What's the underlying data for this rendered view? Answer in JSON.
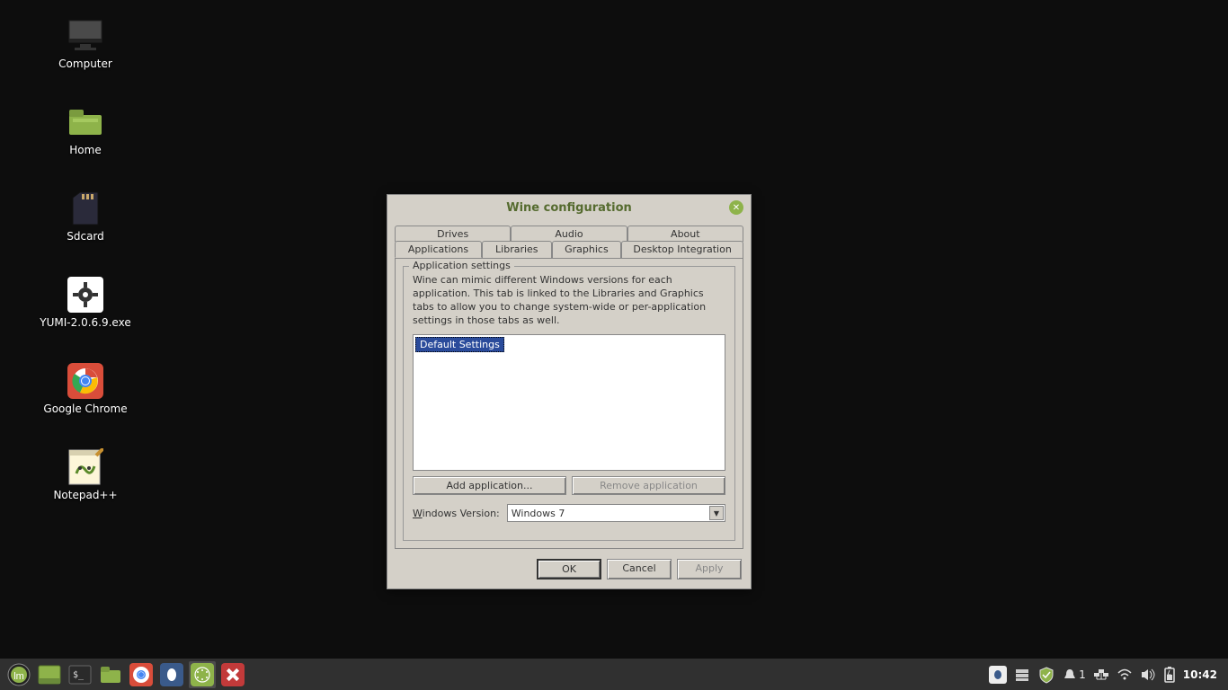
{
  "desktop": {
    "icons": [
      {
        "label": "Computer"
      },
      {
        "label": "Home"
      },
      {
        "label": "Sdcard"
      },
      {
        "label": "YUMI-2.0.6.9.exe"
      },
      {
        "label": "Google Chrome"
      },
      {
        "label": "Notepad++"
      }
    ]
  },
  "window": {
    "title": "Wine configuration",
    "tabs_row1": [
      {
        "label": "Drives"
      },
      {
        "label": "Audio"
      },
      {
        "label": "About"
      }
    ],
    "tabs_row2": [
      {
        "label": "Applications"
      },
      {
        "label": "Libraries"
      },
      {
        "label": "Graphics"
      },
      {
        "label": "Desktop Integration"
      }
    ],
    "active_tab": "Applications",
    "group_title": "Application settings",
    "description": "Wine can mimic different Windows versions for each application. This tab is linked to the Libraries and Graphics tabs to allow you to change system-wide or per-application settings in those tabs as well.",
    "list_selected": "Default Settings",
    "add_button": "Add application...",
    "remove_button": "Remove application",
    "version_label": "Windows Version:",
    "version_value": "Windows 7",
    "footer": {
      "ok": "OK",
      "cancel": "Cancel",
      "apply": "Apply"
    }
  },
  "panel": {
    "notification_count": "1",
    "clock": "10:42"
  }
}
